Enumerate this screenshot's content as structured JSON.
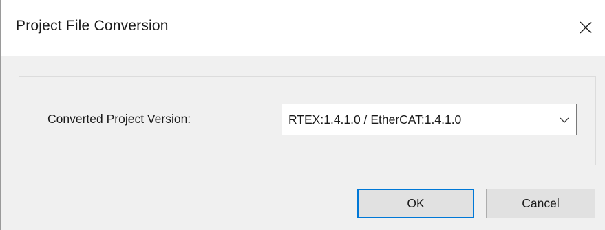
{
  "window": {
    "title": "Project File Conversion"
  },
  "form": {
    "version_label": "Converted Project Version:",
    "version_selected": "RTEX:1.4.1.0 / EtherCAT:1.4.1.0"
  },
  "buttons": {
    "ok_label": "OK",
    "cancel_label": "Cancel"
  },
  "icons": {
    "close": "close-icon",
    "dropdown": "chevron-down-icon"
  },
  "colors": {
    "focus_border": "#0078d7",
    "dialog_background": "#f0f0f0",
    "title_background": "#ffffff"
  }
}
